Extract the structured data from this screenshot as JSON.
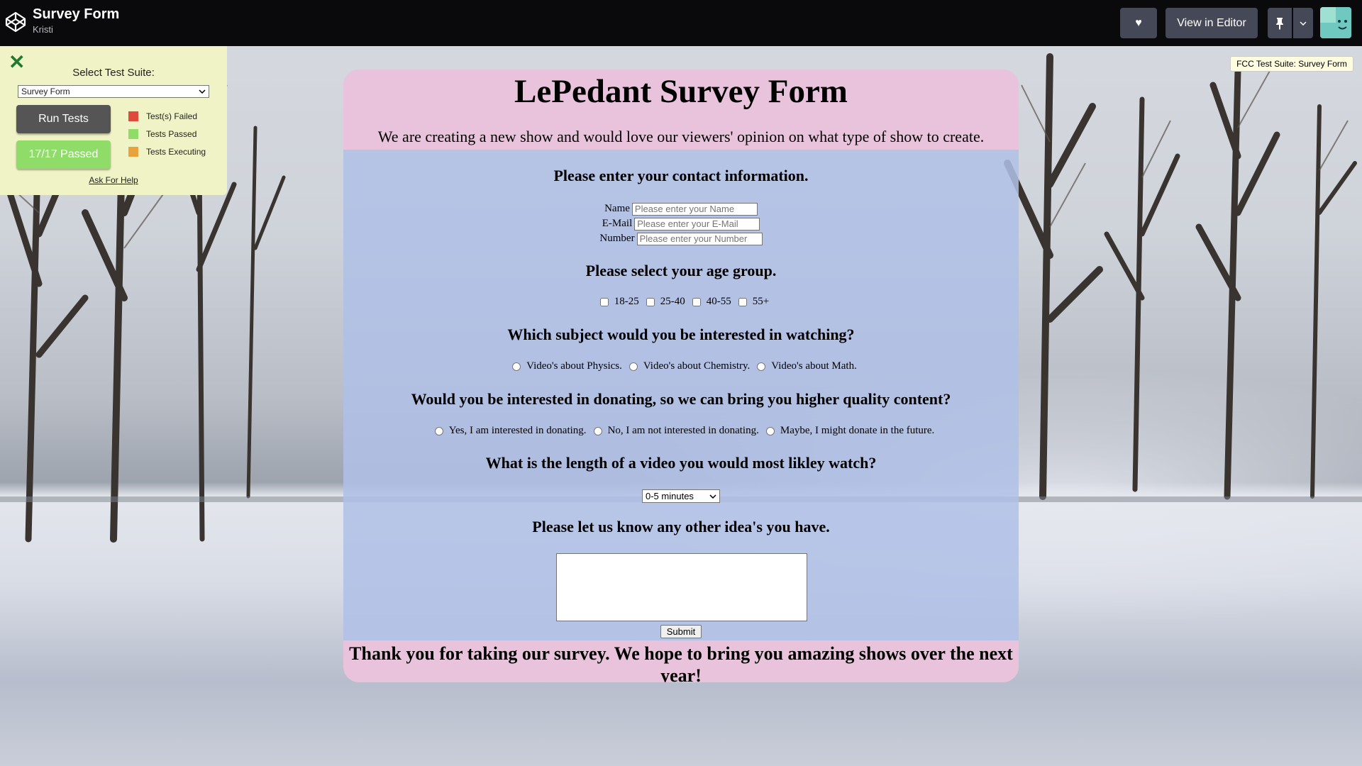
{
  "topbar": {
    "title": "Survey Form",
    "user": "Kristi",
    "view_in_editor": "View in Editor",
    "icons": {
      "logo": "codepen-logo-icon",
      "heart": "heart-icon",
      "pin": "pin-icon",
      "caret": "chevron-down-icon"
    }
  },
  "fcc": {
    "select_label": "Select Test Suite:",
    "selected_suite": "Survey Form",
    "run_tests": "Run Tests",
    "passed": "17/17 Passed",
    "legend": [
      {
        "label": "Test(s) Failed",
        "color": "#e04a3b"
      },
      {
        "label": "Tests Passed",
        "color": "#8fdc69"
      },
      {
        "label": "Tests Executing",
        "color": "#e8a33d"
      }
    ],
    "help": "Ask For Help",
    "badge": "FCC Test Suite: Survey Form"
  },
  "survey": {
    "title": "LePedant Survey Form",
    "description": "We are creating a new show and would love our viewers' opinion on what type of show to create.",
    "contact_heading": "Please enter your contact information.",
    "contact_fields": [
      {
        "label": "Name",
        "placeholder": "Please enter your Name"
      },
      {
        "label": "E-Mail",
        "placeholder": "Please enter your E-Mail"
      },
      {
        "label": "Number",
        "placeholder": "Please enter your Number"
      }
    ],
    "age_heading": "Please select your age group.",
    "age_options": [
      "18-25",
      "25-40",
      "40-55",
      "55+"
    ],
    "subject_heading": "Which subject would you be interested in watching?",
    "subject_options": [
      "Video's about Physics.",
      "Video's about Chemistry.",
      "Video's about Math."
    ],
    "donate_heading": "Would you be interested in donating, so we can bring you higher quality content?",
    "donate_options": [
      "Yes, I am interested in donating.",
      "No, I am not interested in donating.",
      "Maybe, I might donate in the future."
    ],
    "length_heading": "What is the length of a video you would most likley watch?",
    "length_selected": "0-5 minutes",
    "ideas_heading": "Please let us know any other idea's you have.",
    "submit": "Submit",
    "footer": "Thank you for taking our survey. We hope to bring you amazing shows over the next year!"
  },
  "colors": {
    "topbar_bg": "#0a0a0c",
    "card_header": "#e9c3dc",
    "card_body": "#b0c0e6",
    "fcc_panel": "#f0f3c5"
  }
}
